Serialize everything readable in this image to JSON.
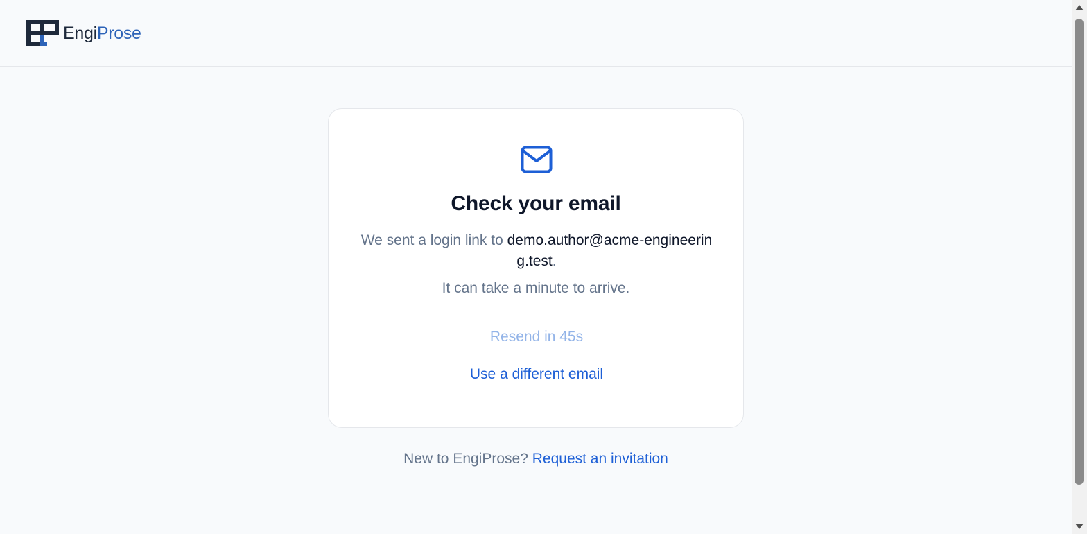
{
  "brand": {
    "name_part1": "Engi",
    "name_part2": "Prose",
    "primary_color": "#1e293b",
    "accent_color": "#2d63b8"
  },
  "card": {
    "icon": "mail-icon",
    "title": "Check your email",
    "sent_prefix": "We sent a login link to ",
    "email": "demo.author@acme-engineering.test",
    "sent_suffix": ".",
    "arrive_text": "It can take a minute to arrive.",
    "resend_label": "Resend in 45s",
    "different_email_label": "Use a different email"
  },
  "footer": {
    "prompt": "New to EngiProse? ",
    "link_label": "Request an invitation"
  },
  "colors": {
    "link": "#1d5fd6",
    "disabled_link": "#93b4e8",
    "muted_text": "#64748b",
    "heading": "#0f172a"
  }
}
